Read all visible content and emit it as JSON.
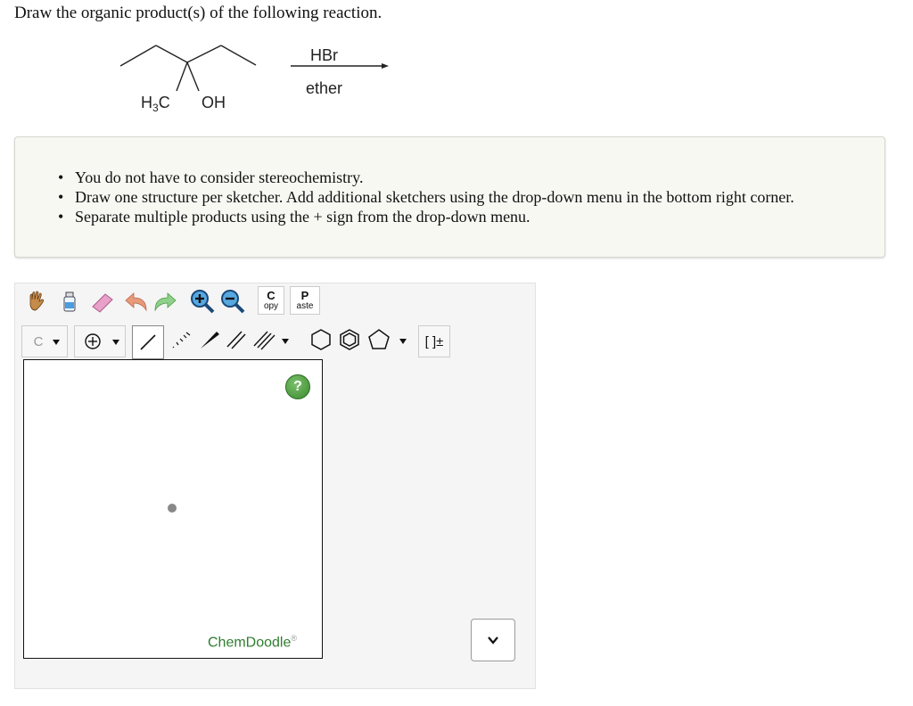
{
  "question": "Draw the organic product(s) of the following reaction.",
  "reaction": {
    "reagent_top": "HBr",
    "reagent_bottom": "ether",
    "label_left": "H3C",
    "label_left_main": "H",
    "label_left_sub": "3",
    "label_left_end": "C",
    "label_right": "OH"
  },
  "instructions": [
    "You do not have to consider stereochemistry.",
    "Draw one structure per sketcher. Add additional sketchers using the drop-down menu in the bottom right corner.",
    "Separate multiple products using the + sign from the drop-down menu."
  ],
  "toolbar": {
    "copy_top": "C",
    "copy_bottom": "opy",
    "paste_top": "P",
    "paste_bottom": "aste",
    "element_label": "C",
    "charge_label": "[ ]±"
  },
  "sketcher": {
    "help_label": "?",
    "brand": "ChemDoodle",
    "brand_mark": "®"
  },
  "colors": {
    "panel_bg": "#f8f8f3",
    "sketcher_bg": "#f5f5f5",
    "brand_green": "#2f7d2f"
  }
}
